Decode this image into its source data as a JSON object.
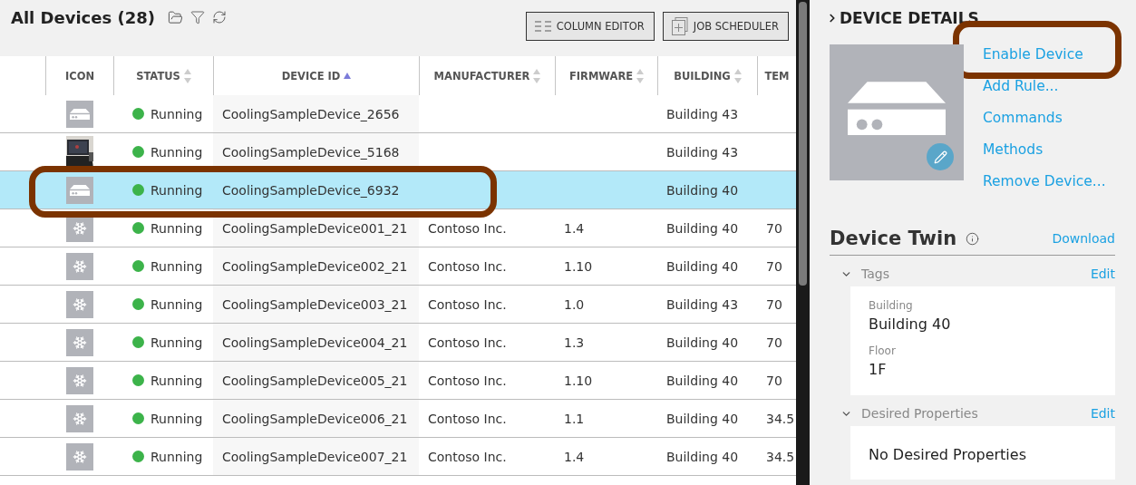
{
  "list": {
    "title": "All Devices (28)",
    "buttons": [
      {
        "kind": "columns",
        "label": "COLUMN EDITOR"
      },
      {
        "kind": "scheduler",
        "label": "JOB SCHEDULER"
      }
    ]
  },
  "table": {
    "columns": [
      {
        "label": "ICON",
        "kind": "plain"
      },
      {
        "label": "STATUS",
        "kind": "sortable"
      },
      {
        "label": "DEVICE ID",
        "kind": "sorted"
      },
      {
        "label": "MANUFACTURER",
        "kind": "sortable"
      },
      {
        "label": "FIRMWARE",
        "kind": "sortable"
      },
      {
        "label": "BUILDING",
        "kind": "sortable"
      },
      {
        "label": "TEM",
        "kind": "plain"
      }
    ],
    "rows": [
      {
        "kind": "device",
        "status": "Running",
        "device_id": "CoolingSampleDevice_2656",
        "manufacturer": "",
        "firmware": "",
        "building": "Building 43",
        "temperature": "",
        "selected": false,
        "highlighted": false
      },
      {
        "kind": "picture",
        "status": "Running",
        "device_id": "CoolingSampleDevice_5168",
        "manufacturer": "",
        "firmware": "",
        "building": "Building 43",
        "temperature": "",
        "selected": false,
        "highlighted": false
      },
      {
        "kind": "device",
        "status": "Running",
        "device_id": "CoolingSampleDevice_6932",
        "manufacturer": "",
        "firmware": "",
        "building": "Building 40",
        "temperature": "",
        "selected": true,
        "highlighted": true
      },
      {
        "kind": "snowflake",
        "status": "Running",
        "device_id": "CoolingSampleDevice001_21",
        "manufacturer": "Contoso Inc.",
        "firmware": "1.4",
        "building": "Building 40",
        "temperature": "70",
        "selected": false,
        "highlighted": false
      },
      {
        "kind": "snowflake",
        "status": "Running",
        "device_id": "CoolingSampleDevice002_21",
        "manufacturer": "Contoso Inc.",
        "firmware": "1.10",
        "building": "Building 40",
        "temperature": "70",
        "selected": false,
        "highlighted": false
      },
      {
        "kind": "snowflake",
        "status": "Running",
        "device_id": "CoolingSampleDevice003_21",
        "manufacturer": "Contoso Inc.",
        "firmware": "1.0",
        "building": "Building 43",
        "temperature": "70",
        "selected": false,
        "highlighted": false
      },
      {
        "kind": "snowflake",
        "status": "Running",
        "device_id": "CoolingSampleDevice004_21",
        "manufacturer": "Contoso Inc.",
        "firmware": "1.3",
        "building": "Building 40",
        "temperature": "70",
        "selected": false,
        "highlighted": false
      },
      {
        "kind": "snowflake",
        "status": "Running",
        "device_id": "CoolingSampleDevice005_21",
        "manufacturer": "Contoso Inc.",
        "firmware": "1.10",
        "building": "Building 40",
        "temperature": "70",
        "selected": false,
        "highlighted": false
      },
      {
        "kind": "snowflake",
        "status": "Running",
        "device_id": "CoolingSampleDevice006_21",
        "manufacturer": "Contoso Inc.",
        "firmware": "1.1",
        "building": "Building 40",
        "temperature": "34.5",
        "selected": false,
        "highlighted": false
      },
      {
        "kind": "snowflake",
        "status": "Running",
        "device_id": "CoolingSampleDevice007_21",
        "manufacturer": "Contoso Inc.",
        "firmware": "1.4",
        "building": "Building 40",
        "temperature": "34.5",
        "selected": false,
        "highlighted": false
      }
    ]
  },
  "details": {
    "title": "DEVICE DETAILS",
    "actions": [
      {
        "label": "Enable Device",
        "highlighted": true
      },
      {
        "label": "Add Rule...",
        "highlighted": false
      },
      {
        "label": "Commands",
        "highlighted": false
      },
      {
        "label": "Methods",
        "highlighted": false
      },
      {
        "label": "Remove Device...",
        "highlighted": false
      }
    ],
    "twin": {
      "title": "Device Twin",
      "download": "Download",
      "sections": [
        {
          "title": "Tags",
          "edit": "Edit",
          "expanded": true,
          "fields": [
            {
              "label": "Building",
              "value": "Building 40"
            },
            {
              "label": "Floor",
              "value": "1F"
            }
          ]
        },
        {
          "title": "Desired Properties",
          "edit": "Edit",
          "expanded": true,
          "empty": "No Desired Properties"
        }
      ]
    }
  }
}
